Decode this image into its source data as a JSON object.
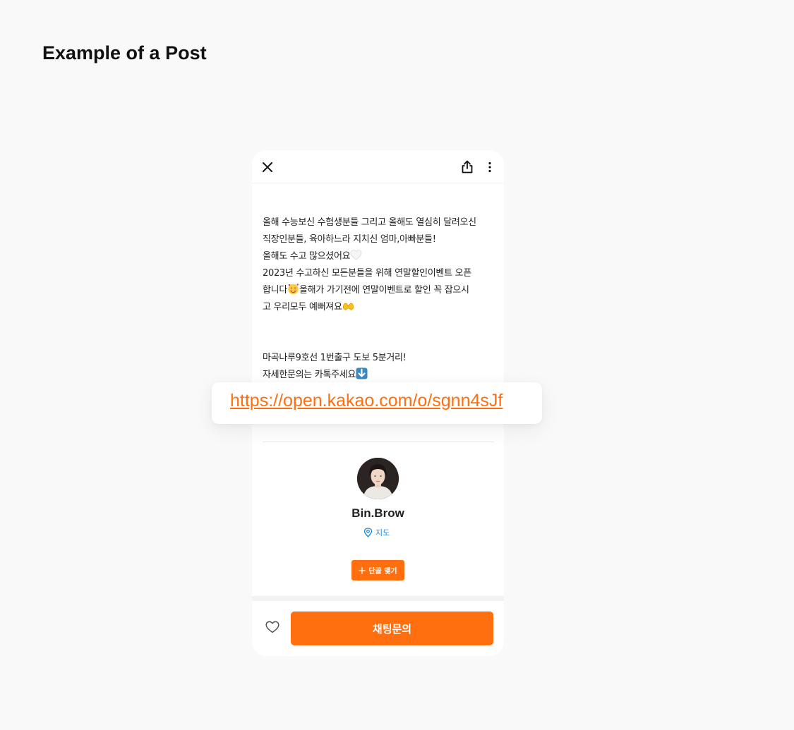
{
  "page": {
    "title": "Example of a Post"
  },
  "header": {
    "icons": [
      "close-icon",
      "share-icon",
      "more-vertical-icon"
    ]
  },
  "post": {
    "paragraph1": [
      "올해 수능보신 수험생분들 그리고 올해도 열심히 달려오신",
      "직장인분들, 육아하느라 지치신 엄마,아빠분들!",
      "올해도 수고 많으셨어요"
    ],
    "paragraph1_line4": "2023년 수고하신 모든분들을 위해 연말할인이벤트 오픈",
    "paragraph1_line5a": "합니다",
    "paragraph1_line5b": "올해가 가기전에 연말이벤트로 할인 꼭 잡으시",
    "paragraph1_line6": "고 우리모두 예뻐져요",
    "paragraph2_line1": "마곡나루9호선 1번출구 도보 5분거리!",
    "paragraph2_line2": "자세한문의는 카톡주세요",
    "emojis": [
      "white-heart",
      "smiling-face-with-hearts",
      "heart-hands",
      "down-arrow"
    ]
  },
  "link": {
    "url": "https://open.kakao.com/o/sgnn4sJf"
  },
  "author": {
    "name": "Bin.Brow",
    "map_label": "지도",
    "follow_label": "단골 맺기"
  },
  "footer": {
    "chat_label": "채팅문의",
    "like_icon": "heart-outline-icon"
  },
  "colors": {
    "accent": "#ff6f0f",
    "map_link": "#1e8ad6",
    "background": "#f9f9f9"
  }
}
